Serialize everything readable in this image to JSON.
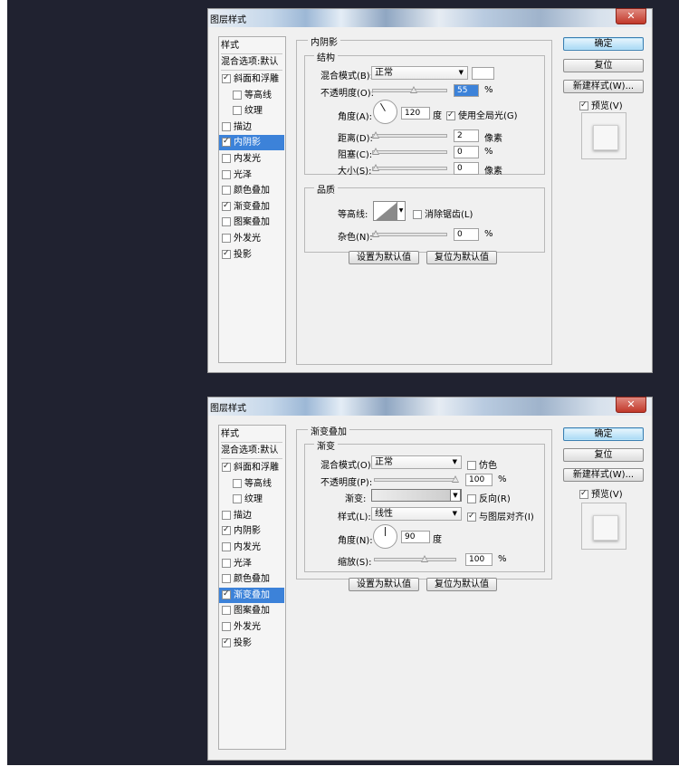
{
  "dialog1": {
    "title": "图层样式",
    "close": "✕",
    "styles_header": "样式",
    "blend_options": "混合选项:默认",
    "styles": [
      {
        "label": "斜面和浮雕",
        "checked": true
      },
      {
        "label": "等高线",
        "checked": false
      },
      {
        "label": "纹理",
        "checked": false
      },
      {
        "label": "描边",
        "checked": false
      },
      {
        "label": "内阴影",
        "checked": true,
        "selected": true
      },
      {
        "label": "内发光",
        "checked": false
      },
      {
        "label": "光泽",
        "checked": false
      },
      {
        "label": "颜色叠加",
        "checked": false
      },
      {
        "label": "渐变叠加",
        "checked": true
      },
      {
        "label": "图案叠加",
        "checked": false
      },
      {
        "label": "外发光",
        "checked": false
      },
      {
        "label": "投影",
        "checked": true
      }
    ],
    "section_title": "内阴影",
    "structure_title": "结构",
    "blend_mode_label": "混合模式(B):",
    "blend_mode_value": "正常",
    "opacity_label": "不透明度(O):",
    "opacity_value": "55",
    "opacity_fraction": 0.55,
    "percent": "%",
    "angle_label": "角度(A):",
    "angle_value": "120",
    "degree": "度",
    "global_light_label": "使用全局光(G)",
    "global_light_checked": true,
    "distance_label": "距离(D):",
    "distance_value": "2",
    "distance_unit": "像素",
    "choke_label": "阻塞(C):",
    "choke_value": "0",
    "size_label": "大小(S):",
    "size_value": "0",
    "size_unit": "像素",
    "quality_title": "品质",
    "contour_label": "等高线:",
    "antialias_label": "消除锯齿(L)",
    "antialias_checked": false,
    "noise_label": "杂色(N):",
    "noise_value": "0",
    "set_default": "设置为默认值",
    "reset_default": "复位为默认值",
    "ok": "确定",
    "reset": "复位",
    "new_style": "新建样式(W)...",
    "preview_label": "预览(V)",
    "preview_checked": true
  },
  "dialog2": {
    "title": "图层样式",
    "close": "✕",
    "styles_header": "样式",
    "blend_options": "混合选项:默认",
    "styles": [
      {
        "label": "斜面和浮雕",
        "checked": true
      },
      {
        "label": "等高线",
        "checked": false
      },
      {
        "label": "纹理",
        "checked": false
      },
      {
        "label": "描边",
        "checked": false
      },
      {
        "label": "内阴影",
        "checked": true
      },
      {
        "label": "内发光",
        "checked": false
      },
      {
        "label": "光泽",
        "checked": false
      },
      {
        "label": "颜色叠加",
        "checked": false
      },
      {
        "label": "渐变叠加",
        "checked": true,
        "selected": true
      },
      {
        "label": "图案叠加",
        "checked": false
      },
      {
        "label": "外发光",
        "checked": false
      },
      {
        "label": "投影",
        "checked": true
      }
    ],
    "section_title": "渐变叠加",
    "gradient_title": "渐变",
    "blend_mode_label": "混合模式(O):",
    "blend_mode_value": "正常",
    "dither_label": "仿色",
    "dither_checked": false,
    "opacity_label": "不透明度(P):",
    "opacity_value": "100",
    "opacity_fraction": 1.0,
    "percent": "%",
    "gradient_label": "渐变:",
    "reverse_label": "反向(R)",
    "reverse_checked": false,
    "style_label": "样式(L):",
    "style_value": "线性",
    "align_label": "与图层对齐(I)",
    "align_checked": true,
    "angle_label": "角度(N):",
    "angle_value": "90",
    "degree": "度",
    "scale_label": "缩放(S):",
    "scale_value": "100",
    "set_default": "设置为默认值",
    "reset_default": "复位为默认值",
    "ok": "确定",
    "reset": "复位",
    "new_style": "新建样式(W)...",
    "preview_label": "预览(V)",
    "preview_checked": true
  },
  "colors": {
    "backdrop": "#202230",
    "dialog_bg": "#f0f0f0",
    "selection": "#3c82d9"
  }
}
